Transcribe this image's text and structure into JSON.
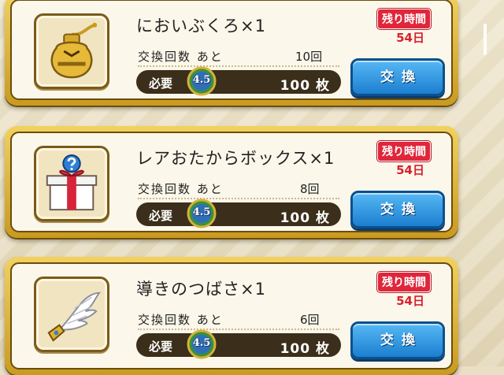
{
  "items": [
    {
      "name": "においぶくろ×1",
      "icon": "scent-bag-icon",
      "remaining_label": "残り時間",
      "remaining_value": "54日",
      "exchange_label": "交換回数 あと",
      "exchange_count": "10回",
      "cost_label": "必要",
      "medal_text": "4.5",
      "cost_value": "100 枚",
      "button_label": "交換"
    },
    {
      "name": "レアおたからボックス×1",
      "icon": "mystery-gift-box-icon",
      "remaining_label": "残り時間",
      "remaining_value": "54日",
      "exchange_label": "交換回数 あと",
      "exchange_count": "8回",
      "cost_label": "必要",
      "medal_text": "4.5",
      "cost_value": "100 枚",
      "button_label": "交換"
    },
    {
      "name": "導きのつばさ×1",
      "icon": "guiding-wing-icon",
      "remaining_label": "残り時間",
      "remaining_value": "54日",
      "exchange_label": "交換回数 あと",
      "exchange_count": "6回",
      "cost_label": "必要",
      "medal_text": "4.5",
      "cost_value": "100 枚",
      "button_label": "交換"
    }
  ],
  "colors": {
    "timer_red": "#e0263a",
    "button_blue": "#1c7fd0",
    "card_gold": "#d9aa2c",
    "cost_bar": "#3b2e1a"
  }
}
